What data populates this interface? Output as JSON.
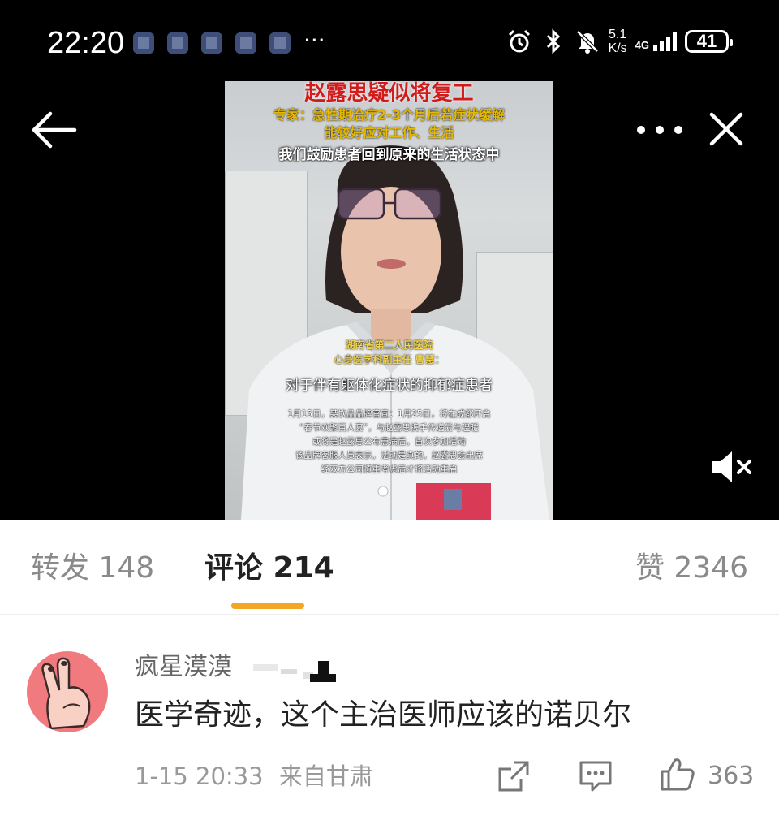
{
  "status_bar": {
    "time": "22:20",
    "more_dots": "···",
    "net_speed_top": "5.1",
    "net_speed_bottom": "K/s",
    "network": "4G",
    "battery": "41"
  },
  "video": {
    "title_partial": "赵露思疑似将复工",
    "expert_line1": "专家：急性期治疗2-3个月后若症状缓解",
    "expert_line2": "能较好应对工作、生活",
    "quote": "我们鼓励患者回到原来的生活状态中",
    "hospital": "湖南省第二人民医院",
    "doctor": "心身医学科副主任 曹慧：",
    "subtitle": "对于伴有躯体化症状的抑郁症患者",
    "notice_lines": [
      "1月15日，某饮品品牌官宣：1月25日，将在成都开启",
      "“春节欢聚百人宴”，与赵露思携手传递爱与温暖",
      "或将是赵露思公布患病后，首次参加活动",
      "该品牌客服人员表示，活动是真的，赵露思会出席",
      "经双方公司慎重考虑后才将活动重启"
    ]
  },
  "tabs": {
    "repost": "转发 148",
    "comments": "评论 214",
    "likes": "赞 2346"
  },
  "comment": {
    "username": "疯星漠漠",
    "text": "医学奇迹，这个主治医师应该的诺贝尔",
    "time": "1-15 20:33",
    "location": "来自甘肃",
    "like_count": "363"
  },
  "colors": {
    "accent_underline": "#f5a623",
    "avatar_bg": "#f07a7e"
  },
  "icons": [
    "back-arrow-icon",
    "more-icon",
    "close-icon",
    "mute-icon",
    "share-icon",
    "reply-icon",
    "like-icon",
    "alarm-icon",
    "bluetooth-icon",
    "silent-icon",
    "signal-icon",
    "battery-icon"
  ]
}
